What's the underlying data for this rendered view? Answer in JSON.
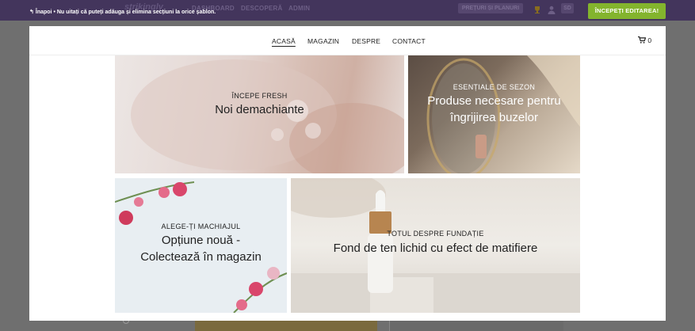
{
  "editor": {
    "logo": "strikingly",
    "ghost_nav": [
      "DASHBOARD",
      "DESCOPERĂ",
      "ADMIN"
    ],
    "ghost_pricing": "PREȚURI ȘI PLANURI",
    "ghost_avatar": "SD",
    "back_label": "Înapoi",
    "tip": "Nu uitați că puteți adăuga și elimina secțiuni la orice șablon.",
    "start_button": "ÎNCEPEȚI EDITAREA!"
  },
  "site": {
    "nav": [
      "ACASĂ",
      "MAGAZIN",
      "DESPRE",
      "CONTACT"
    ],
    "cart_count": "0"
  },
  "tiles": [
    {
      "kicker": "ÎNCEPE FRESH",
      "heading": "Noi demachiante"
    },
    {
      "kicker": "ESENȚIALE DE SEZON",
      "heading": "Produse necesare pentru îngrijirea buzelor"
    },
    {
      "kicker": "ALEGE-ȚI MACHIAJUL",
      "heading": "Opțiune nouă - Colectează în magazin"
    },
    {
      "kicker": "TOTUL DESPRE FUNDAȚIE",
      "heading": "Fond de ten lichid cu efect de matifiere"
    }
  ],
  "colors": {
    "editor_bar": "#43355c",
    "start_button": "#83b42d",
    "overlay": "#6f6f6f"
  },
  "icons": [
    "back-arrow-icon",
    "trophy-icon",
    "user-icon",
    "cart-icon"
  ]
}
